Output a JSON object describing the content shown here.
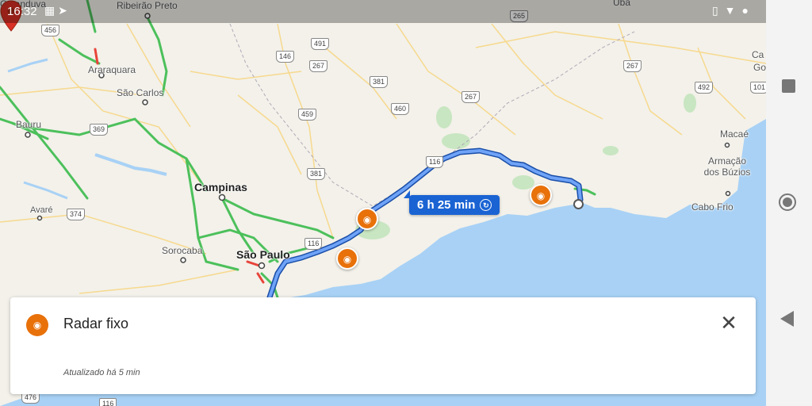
{
  "status_bar": {
    "time": "16:32",
    "left_icons": [
      "image-icon",
      "signal-flag-icon"
    ],
    "right_icons": [
      "vibrate-icon",
      "wifi-icon",
      "person-icon"
    ]
  },
  "map": {
    "cities": [
      {
        "id": "catanduva",
        "label": "Catanduva",
        "big": false
      },
      {
        "id": "ribeirao-preto",
        "label": "Ribeirão Preto",
        "big": false
      },
      {
        "id": "araraquara",
        "label": "Araraquara",
        "big": false
      },
      {
        "id": "sao-carlos",
        "label": "São Carlos",
        "big": false
      },
      {
        "id": "bauru",
        "label": "Bauru",
        "big": false
      },
      {
        "id": "campinas",
        "label": "Campinas",
        "big": true
      },
      {
        "id": "avare",
        "label": "Avaré",
        "big": false
      },
      {
        "id": "sorocaba",
        "label": "Sorocaba",
        "big": false
      },
      {
        "id": "sao-paulo",
        "label": "São Paulo",
        "big": true
      },
      {
        "id": "uba",
        "label": "Ubá",
        "big": false
      },
      {
        "id": "macae",
        "label": "Macaé",
        "big": false
      },
      {
        "id": "armacao",
        "label": "Armação dos Búzios",
        "big": false
      },
      {
        "id": "cabo-frio",
        "label": "Cabo Frio",
        "big": false
      },
      {
        "id": "ca",
        "label": "Ca",
        "big": false
      },
      {
        "id": "go",
        "label": "Go",
        "big": false
      }
    ],
    "road_shields": [
      "456",
      "265",
      "491",
      "146",
      "267",
      "381",
      "460",
      "267",
      "267",
      "369",
      "459",
      "116",
      "381",
      "374",
      "116",
      "492",
      "101",
      "476",
      "116"
    ],
    "route_label": "6 h 25 min",
    "route_color": "#1a63d3",
    "radar_color": "#e8710a",
    "radar_icon": "speed-camera-icon",
    "destination_icon": "map-pin-icon"
  },
  "sheet": {
    "title": "Radar fixo",
    "updated": "Atualizado há 5 min",
    "icon": "speed-camera-icon",
    "close_icon": "close-icon"
  },
  "nav_bar": {
    "buttons": [
      "recent-apps-icon",
      "home-icon",
      "back-icon"
    ]
  }
}
